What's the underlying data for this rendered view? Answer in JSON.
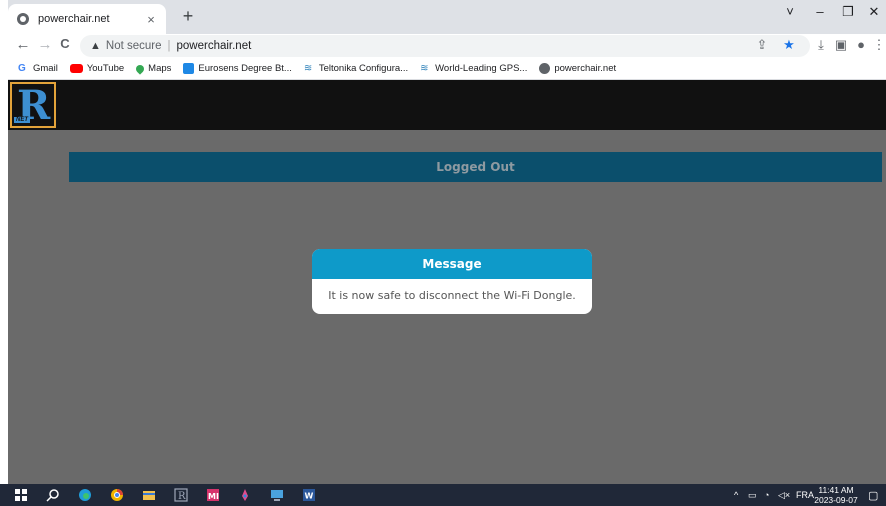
{
  "browser": {
    "tab_title": "powerchair.net",
    "tab_close": "×",
    "new_tab": "+",
    "window_controls": {
      "dropdown": "˅",
      "minimize": "–",
      "restore": "❐",
      "close": "✕"
    },
    "nav": {
      "back": "←",
      "forward": "→",
      "reload": "C"
    },
    "address": {
      "security_label": "Not secure",
      "separator": "|",
      "url": "powerchair.net"
    },
    "bookmarks": [
      {
        "label": "Gmail",
        "icon": "gmail-icon",
        "color": "#4285f4"
      },
      {
        "label": "YouTube",
        "icon": "youtube-icon",
        "color": "#ff0000"
      },
      {
        "label": "Maps",
        "icon": "maps-icon",
        "color": "#34a853"
      },
      {
        "label": "Eurosens Degree Bt...",
        "icon": "eurosens-icon",
        "color": "#1e88e5"
      },
      {
        "label": "Teltonika Configura...",
        "icon": "teltonika-icon",
        "color": "#2a7fb8"
      },
      {
        "label": "World-Leading GPS...",
        "icon": "teltonika-icon",
        "color": "#2a7fb8"
      },
      {
        "label": "powerchair.net",
        "icon": "globe-icon",
        "color": "#5f6368"
      }
    ]
  },
  "page": {
    "logo": {
      "letter": "R",
      "sub": "NET"
    },
    "status_banner": "Logged Out",
    "dialog": {
      "title": "Message",
      "body": "It is now safe to disconnect the Wi-Fi Dongle."
    }
  },
  "taskbar": {
    "language": "FRA",
    "time": "11:41 AM",
    "date": "2023-09-07",
    "accent": "#202838"
  }
}
